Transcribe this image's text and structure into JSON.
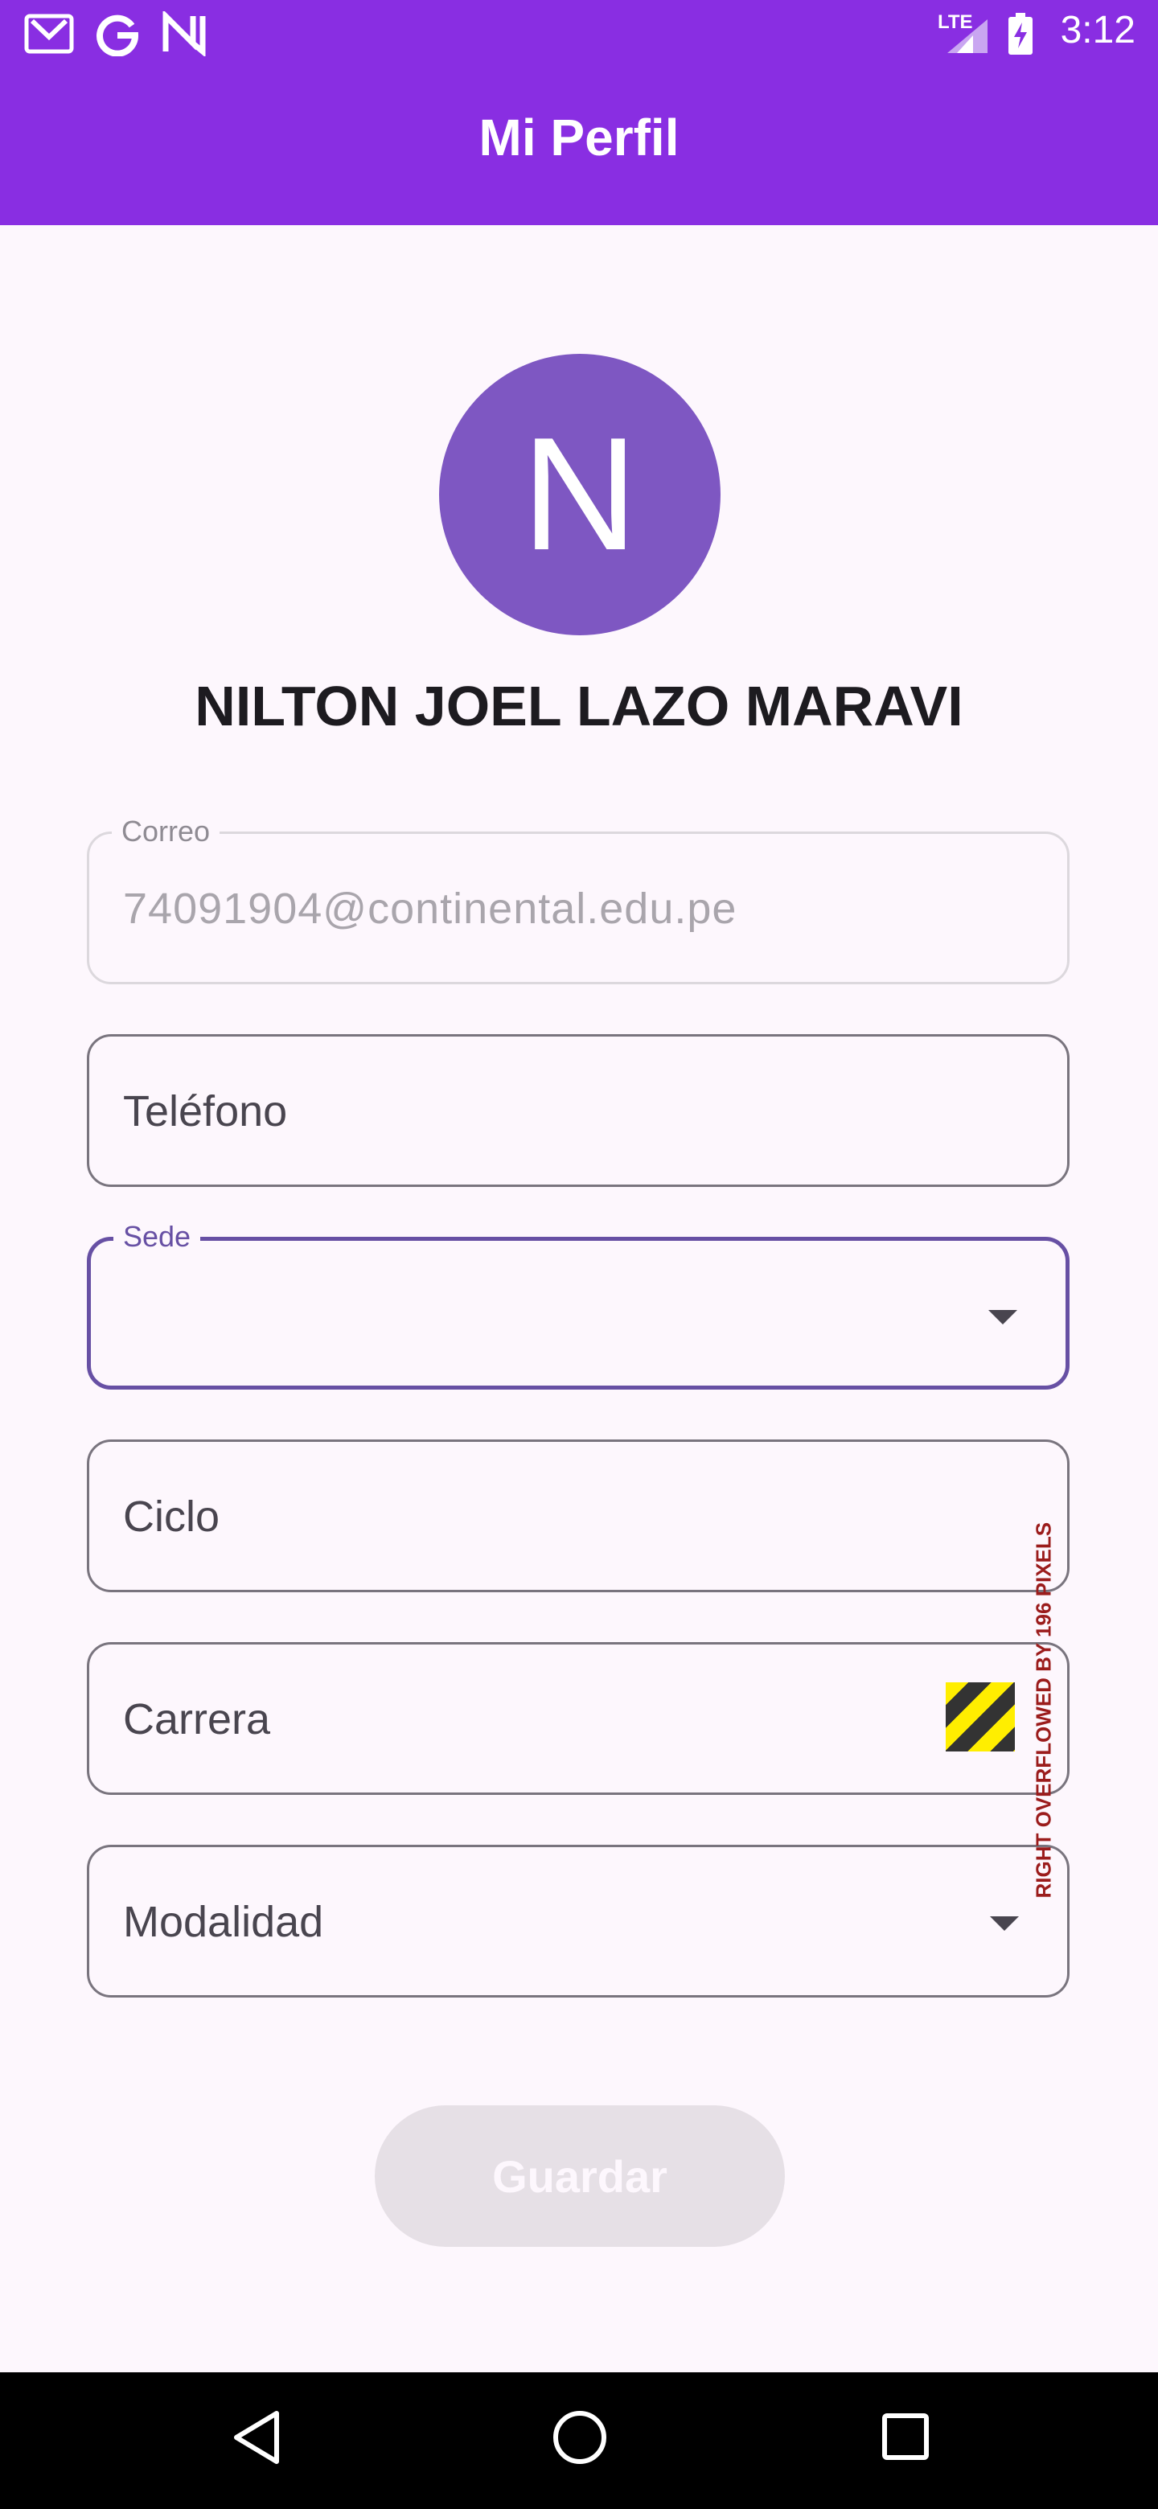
{
  "status_bar": {
    "time": "3:12",
    "network_label": "LTE",
    "left_icons": [
      "gmail-icon",
      "google-icon",
      "n-app-icon"
    ],
    "right_icons": [
      "signal-icon",
      "battery-charging-icon"
    ]
  },
  "app_bar": {
    "title": "Mi Perfil"
  },
  "profile": {
    "avatar_initial": "N",
    "full_name": "NILTON JOEL LAZO MARAVI"
  },
  "form": {
    "correo": {
      "label": "Correo",
      "value": "74091904@continental.edu.pe"
    },
    "telefono": {
      "label": "Teléfono"
    },
    "sede": {
      "label": "Sede",
      "value": ""
    },
    "ciclo": {
      "label": "Ciclo"
    },
    "carrera": {
      "label": "Carrera"
    },
    "modalidad": {
      "label": "Modalidad"
    },
    "overflow_warning": "RIGHT OVERFLOWED BY 196 PIXELS"
  },
  "save_button": {
    "label": "Guardar"
  },
  "nav_bar": {
    "buttons": [
      "back-icon",
      "home-icon",
      "recents-icon"
    ]
  },
  "colors": {
    "primary": "#892ee2",
    "avatar": "#7e57c2",
    "focused_border": "#6750a4",
    "background": "#fdf7fd"
  }
}
